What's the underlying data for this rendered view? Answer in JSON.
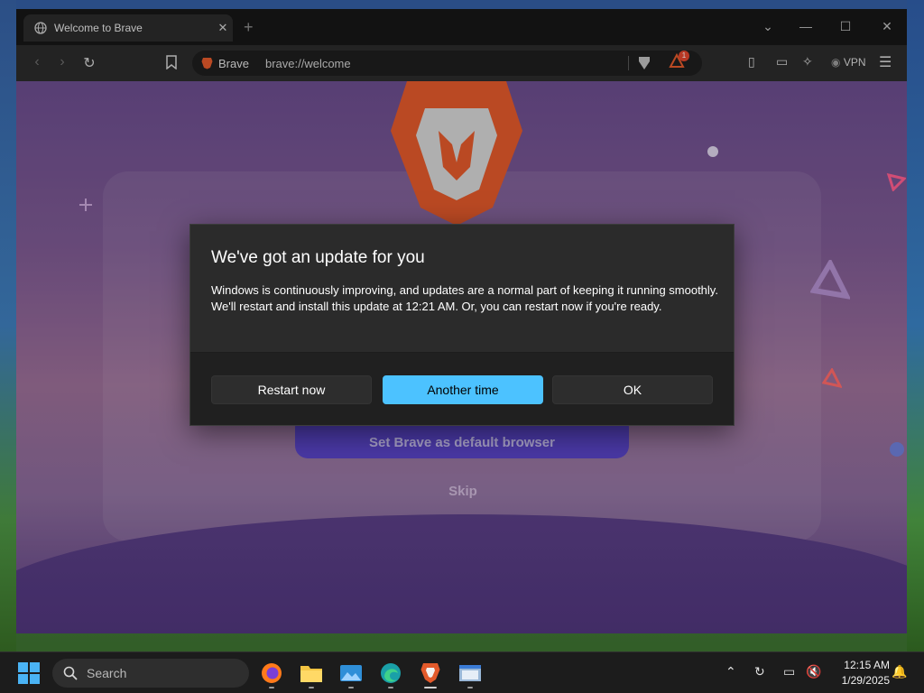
{
  "browser": {
    "tab_title": "Welcome to Brave",
    "new_tab": "+",
    "brand_chip": "Brave",
    "url": "brave://welcome",
    "vpn_label": "VPN",
    "shields_badge": "1"
  },
  "page": {
    "default_button_label": "Set Brave as default browser",
    "skip_label": "Skip"
  },
  "dialog": {
    "title": "We've got an update for you",
    "message": "Windows is continuously improving, and updates are a normal part of keeping it running smoothly. We'll restart and install this update at 12:21 AM. Or, you can restart now if you're ready.",
    "restart_label": "Restart now",
    "another_time_label": "Another time",
    "ok_label": "OK"
  },
  "taskbar": {
    "search_placeholder": "Search",
    "time": "12:15 AM",
    "date": "1/29/2025",
    "apps": [
      "firefox-icon",
      "file-explorer-icon",
      "photos-icon",
      "edge-icon",
      "brave-icon",
      "window-app-icon"
    ]
  },
  "colors": {
    "accent": "#4cc2ff",
    "dialog_bg": "#2b2b2b",
    "brave_orange": "#e35a2b"
  }
}
